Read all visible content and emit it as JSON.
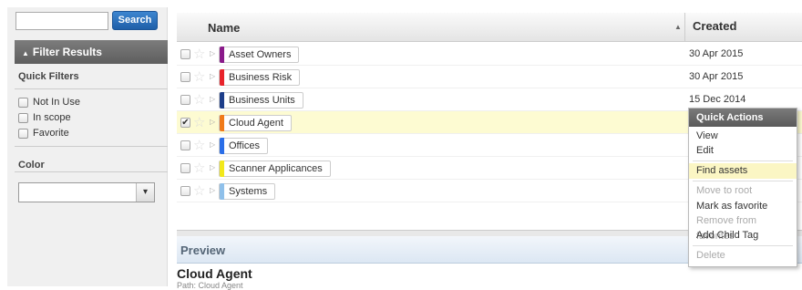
{
  "search": {
    "value": "",
    "button_label": "Search"
  },
  "filter": {
    "header": "Filter Results",
    "quick_filters_label": "Quick Filters",
    "quick_filters": [
      {
        "label": "Not In Use"
      },
      {
        "label": "In scope"
      },
      {
        "label": "Favorite"
      }
    ],
    "color_label": "Color",
    "color_value": ""
  },
  "grid": {
    "col_name": "Name",
    "col_created": "Created",
    "rows": [
      {
        "name": "Asset Owners",
        "created": "30 Apr 2015",
        "color": "#8a1a8a",
        "checked": false
      },
      {
        "name": "Business Risk",
        "created": "30 Apr 2015",
        "color": "#e8232a",
        "checked": false
      },
      {
        "name": "Business Units",
        "created": "15 Dec 2014",
        "color": "#1d3e8a",
        "checked": false
      },
      {
        "name": "Cloud Agent",
        "created": "",
        "color": "#f07b1a",
        "checked": true
      },
      {
        "name": "Offices",
        "created": "",
        "color": "#2a6ee8",
        "checked": false
      },
      {
        "name": "Scanner Applicances",
        "created": "",
        "color": "#f2e81a",
        "checked": false
      },
      {
        "name": "Systems",
        "created": "",
        "color": "#8fc0ea",
        "checked": false
      }
    ]
  },
  "preview": {
    "title": "Preview",
    "name": "Cloud Agent",
    "path": "Path: Cloud Agent"
  },
  "quick_actions": {
    "title": "Quick Actions",
    "items": [
      {
        "label": "View",
        "disabled": false
      },
      {
        "label": "Edit",
        "disabled": false
      },
      {
        "label": "Find assets",
        "disabled": false
      },
      {
        "label": "Move to root",
        "disabled": true
      },
      {
        "label": "Mark as favorite",
        "disabled": false
      },
      {
        "label": "Remove from favorites",
        "disabled": true
      },
      {
        "label": "Add Child Tag",
        "disabled": false
      },
      {
        "label": "Delete",
        "disabled": true
      }
    ]
  },
  "icons": {
    "check": "✔",
    "star": "☆",
    "expand": "▷",
    "sort": "▲",
    "filter_tri": "▲",
    "dropdown": "▾"
  }
}
